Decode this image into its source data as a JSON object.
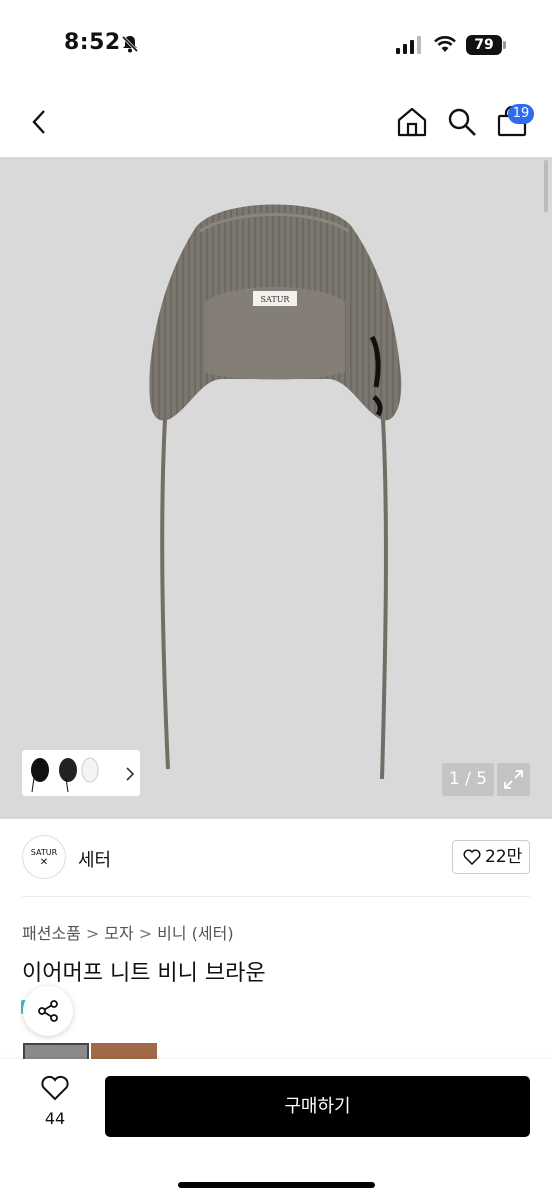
{
  "status_bar": {
    "time": "8:52",
    "battery": "79"
  },
  "header": {
    "cart_count": "19"
  },
  "gallery": {
    "counter": "1 / 5",
    "brand_tag": "SATUR"
  },
  "brand": {
    "logo_text": "SATUR",
    "name": "세터",
    "likes": "22만"
  },
  "breadcrumb": {
    "items": [
      "패션소품",
      "모자",
      "비니 (세터)"
    ],
    "separator": ">"
  },
  "product": {
    "title": "이어머프 니트 비니 브라운"
  },
  "bottom_bar": {
    "wish_count": "44",
    "buy_label": "구매하기"
  },
  "colors": {
    "accent": "#2f6bf0",
    "buy_button": "#000000",
    "image_bg": "#d9d9da"
  }
}
